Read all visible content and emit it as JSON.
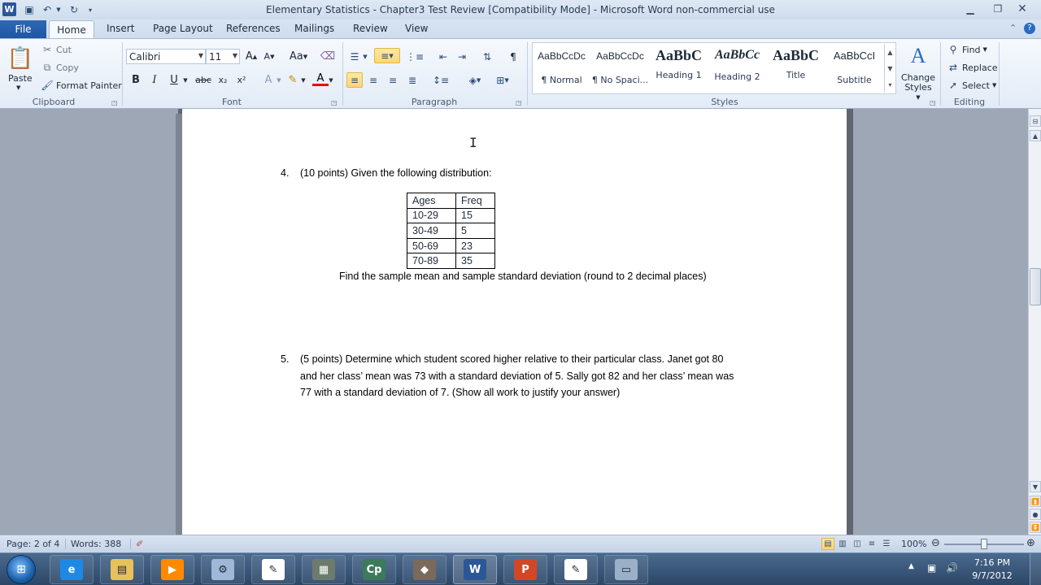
{
  "window": {
    "title": "Elementary Statistics - Chapter3 Test Review [Compatibility Mode]  -  Microsoft Word non-commercial use",
    "app_icon_letter": "W"
  },
  "tabs": {
    "file": "File",
    "items": [
      "Home",
      "Insert",
      "Page Layout",
      "References",
      "Mailings",
      "Review",
      "View"
    ]
  },
  "clipboard": {
    "paste": "Paste",
    "cut": "Cut",
    "copy": "Copy",
    "format_painter": "Format Painter",
    "group_label": "Clipboard"
  },
  "font": {
    "family": "Calibri",
    "size": "11",
    "group_label": "Font",
    "grow": "A",
    "shrink": "A",
    "change_case": "Aa",
    "bold": "B",
    "italic": "I",
    "underline": "U",
    "strikethrough": "abc",
    "subscript": "x₂",
    "superscript": "x²",
    "text_effects": "A",
    "font_color": "A"
  },
  "paragraph": {
    "group_label": "Paragraph",
    "show_marks": "¶"
  },
  "styles": {
    "group_label": "Styles",
    "items": [
      {
        "sample": "AaBbCcDc",
        "name": "¶ Normal"
      },
      {
        "sample": "AaBbCcDc",
        "name": "¶ No Spaci..."
      },
      {
        "sample": "AaBbC",
        "name": "Heading 1"
      },
      {
        "sample": "AaBbCc",
        "name": "Heading 2"
      },
      {
        "sample": "AaBbC",
        "name": "Title"
      },
      {
        "sample": "AaBbCcI",
        "name": "Subtitle"
      }
    ],
    "change_styles": "Change Styles"
  },
  "editing": {
    "group_label": "Editing",
    "find": "Find",
    "replace": "Replace",
    "select": "Select"
  },
  "document": {
    "q4_number": "4.",
    "q4_text": "(10 points) Given the following distribution:",
    "table": {
      "headers": [
        "Ages",
        "Freq"
      ],
      "rows": [
        [
          "10-29",
          "15"
        ],
        [
          "30-49",
          "5"
        ],
        [
          "50-69",
          "23"
        ],
        [
          "70-89",
          "35"
        ]
      ]
    },
    "q4_instruction": "Find the sample mean and sample standard deviation (round to 2 decimal places)",
    "q5_number": "5.",
    "q5_lines": [
      "(5 points) Determine which student scored higher relative to their particular class.  Janet got 80",
      "and her class’ mean was 73 with a standard deviation of 5.  Sally got 82 and her class’ mean was",
      "77 with a standard deviation of 7.  (Show all work to justify your answer)"
    ]
  },
  "statusbar": {
    "page": "Page: 2 of 4",
    "words": "Words: 388",
    "zoom": "100%",
    "zoom_level_fraction": 0.5
  },
  "taskbar": {
    "time": "7:16 PM",
    "date": "9/7/2012",
    "apps": [
      {
        "name": "internet-explorer",
        "glyph": "e",
        "color": "#1e88e5"
      },
      {
        "name": "file-explorer",
        "glyph": "▤",
        "color": "#e8c15a"
      },
      {
        "name": "media-player",
        "glyph": "▶",
        "color": "#ff8a00"
      },
      {
        "name": "network-tool",
        "glyph": "⚙",
        "color": "#9fb8d8"
      },
      {
        "name": "writer-tool",
        "glyph": "✎",
        "color": "#ffffff"
      },
      {
        "name": "calculator",
        "glyph": "▦",
        "color": "#6d7b6d"
      },
      {
        "name": "captivate",
        "glyph": "Cp",
        "color": "#3c7a5a"
      },
      {
        "name": "game-app",
        "glyph": "◆",
        "color": "#7a6a5a"
      },
      {
        "name": "word",
        "glyph": "W",
        "color": "#2b5797"
      },
      {
        "name": "powerpoint",
        "glyph": "P",
        "color": "#d24726"
      },
      {
        "name": "pen-tool",
        "glyph": "✎",
        "color": "#ffffff"
      },
      {
        "name": "notepad",
        "glyph": "▭",
        "color": "#9ab0c8"
      }
    ]
  }
}
